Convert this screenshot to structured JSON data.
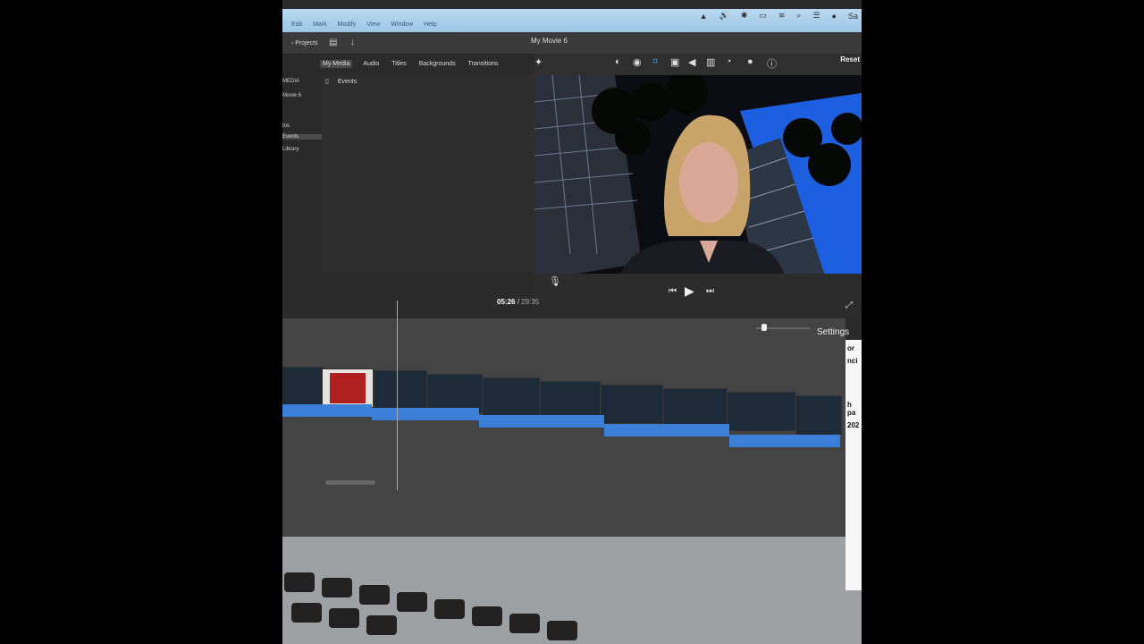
{
  "menubar": {
    "items": [
      "Edit",
      "Mark",
      "Modify",
      "View",
      "Window",
      "Help"
    ],
    "user_label": "Sa"
  },
  "toolbar": {
    "projects_label": "Projects",
    "movie_title": "My Movie 6"
  },
  "browser": {
    "tabs": [
      "My Media",
      "Audio",
      "Titles",
      "Backgrounds",
      "Transitions"
    ],
    "active_tab": "My Media",
    "events_header": "Events"
  },
  "sidebar": {
    "items": [
      "MEDIA",
      "Movie 6",
      "tos",
      "Events",
      "Library"
    ],
    "selected": "Events"
  },
  "viewer": {
    "reset_label": "Reset",
    "current_time": "05:26",
    "separator": "/",
    "total_time": "29:35"
  },
  "timeline": {
    "settings_label": "Settings"
  },
  "right_edge": {
    "texts": [
      "or",
      "nci",
      "h pa",
      "202"
    ]
  },
  "colors": {
    "accent_blue": "#3b7fd9",
    "menubar_blue": "#a8cfea"
  }
}
